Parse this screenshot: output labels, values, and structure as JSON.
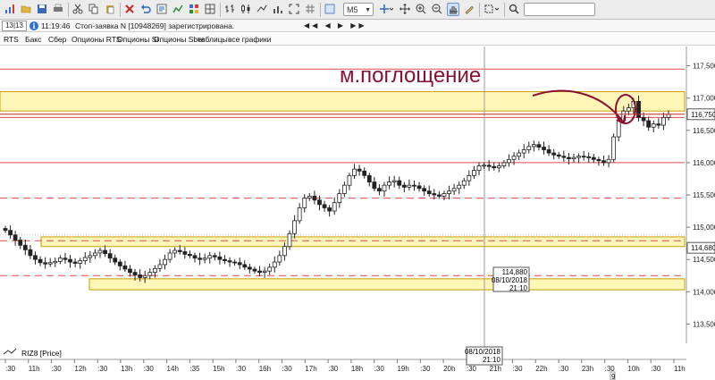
{
  "toolbar": {
    "pager": "13|13",
    "timeframe": "M5",
    "search_placeholder": ""
  },
  "status": {
    "time": "11:19:46",
    "message": "Стоп-заявка N [10948269] зарегистрирована.",
    "nav": "◀◀ ◀ ▶ ▶▶"
  },
  "tabs": [
    {
      "label": "RTS"
    },
    {
      "label": "Бакс"
    },
    {
      "label": "Сбер"
    },
    {
      "label": "Опционы RTS"
    },
    {
      "label": "Опционы Si"
    },
    {
      "label": "Опционы Sber"
    },
    {
      "label": "таблицы"
    },
    {
      "label": "все графики"
    }
  ],
  "colors": {
    "zone_fill": "#fff6b8",
    "zone_border": "#c9a000",
    "level_line": "#e24a4a",
    "annotation": "#8b1030",
    "last_price_line": "#c62828"
  },
  "annotation_text": "м.поглощение",
  "legend": "RIZ8 [Price]",
  "crosshair": {
    "price": "114,880",
    "date": "08/10/2018",
    "time": "21:10",
    "axis_date": "08/10/2018",
    "axis_time": "21:10"
  },
  "price_axis": {
    "ticks": [
      "117,500",
      "117,000",
      "116,500",
      "116,000",
      "115,500",
      "115,000",
      "114,500",
      "114,000",
      "113,500"
    ],
    "last_price": "116,750",
    "marker_price": "114,680"
  },
  "time_axis": {
    "labels": [
      ":30",
      "11h",
      ":30",
      "12h",
      ":30",
      "13h",
      ":30",
      "14h",
      ":35",
      "15h",
      ":30",
      "16h",
      ":30",
      "17h",
      ":30",
      "18h",
      ":30",
      "19h",
      ":30",
      "20h",
      ":30",
      "21h",
      ":30",
      "22h",
      ":30",
      "23h",
      ":30",
      "10h",
      ":30",
      "11h"
    ],
    "day_marker": "9"
  },
  "chart_data": {
    "type": "candlestick",
    "instrument": "RIZ8 [Price]",
    "timeframe": "M5",
    "ylim": [
      113200,
      117800
    ],
    "zones": [
      {
        "from": 116800,
        "to": 117100
      },
      {
        "from": 114700,
        "to": 114850
      },
      {
        "from": 114030,
        "to": 114200
      }
    ],
    "levels": [
      117450,
      116700,
      116000,
      115450,
      114790,
      114250
    ],
    "closes": [
      114950,
      114880,
      114800,
      114720,
      114650,
      114560,
      114500,
      114450,
      114430,
      114450,
      114470,
      114520,
      114500,
      114460,
      114440,
      114480,
      114530,
      114560,
      114600,
      114640,
      114590,
      114520,
      114460,
      114400,
      114350,
      114300,
      114260,
      114220,
      114250,
      114300,
      114360,
      114420,
      114500,
      114600,
      114640,
      114620,
      114580,
      114560,
      114520,
      114500,
      114520,
      114560,
      114540,
      114500,
      114480,
      114460,
      114450,
      114420,
      114380,
      114350,
      114320,
      114300,
      114320,
      114380,
      114460,
      114560,
      114700,
      114900,
      115100,
      115300,
      115450,
      115480,
      115420,
      115350,
      115300,
      115250,
      115380,
      115520,
      115650,
      115800,
      115900,
      115870,
      115800,
      115700,
      115600,
      115560,
      115650,
      115700,
      115720,
      115650,
      115620,
      115650,
      115640,
      115600,
      115560,
      115520,
      115500,
      115480,
      115520,
      115560,
      115600,
      115650,
      115720,
      115800,
      115880,
      115950,
      115960,
      115940,
      115920,
      115950,
      116000,
      116050,
      116100,
      116150,
      116200,
      116250,
      116280,
      116240,
      116200,
      116150,
      116120,
      116100,
      116080,
      116060,
      116080,
      116100,
      116090,
      116080,
      116050,
      116030,
      116000,
      116050,
      116400,
      116650,
      116800,
      116850,
      116950,
      116700,
      116650,
      116550,
      116600,
      116580,
      116700,
      116750
    ]
  }
}
